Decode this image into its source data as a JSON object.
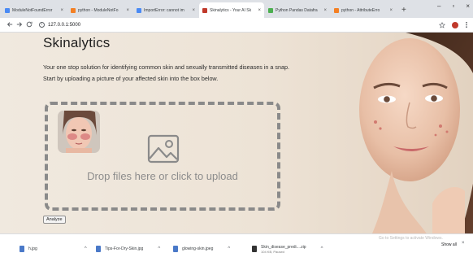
{
  "browser": {
    "tabs": [
      {
        "title": "ModuleNotFoundError",
        "favicon_color": "#4a8af4",
        "active": false
      },
      {
        "title": "python - ModuleNotFo",
        "favicon_color": "#f48024",
        "active": false
      },
      {
        "title": "ImportError: cannot im",
        "favicon_color": "#4a8af4",
        "active": false
      },
      {
        "title": "Skinalytics - Your AI Sk",
        "favicon_color": "#c0392b",
        "active": true
      },
      {
        "title": "Python Pandas Datafra",
        "favicon_color": "#4caf50",
        "active": false
      },
      {
        "title": "python - AttributeErro",
        "favicon_color": "#f48024",
        "active": false
      }
    ],
    "close_glyph": "×",
    "new_tab_glyph": "+",
    "url": "127.0.0.1:5000",
    "window_controls": [
      "–",
      "▫",
      "×"
    ]
  },
  "page": {
    "brand": "Skinalytics",
    "intro_line1": "Your one stop solution for identifying common skin and sexually transmitted diseases in a snap.",
    "intro_line2": "Start by uploading a picture of your affected skin into the box below.",
    "drop_text": "Drop files here or click to upload",
    "analyze_label": "Analyze"
  },
  "downloads": {
    "items": [
      {
        "name": "h.jpg",
        "sub": "",
        "type": "image"
      },
      {
        "name": "Tips-For-Dry-Skin.jpg",
        "sub": "",
        "type": "image"
      },
      {
        "name": "glowing-skin.jpeg",
        "sub": "",
        "type": "image"
      },
      {
        "name": "Skin_disease_predi....zip",
        "sub": "104 KB, Paused",
        "type": "archive"
      }
    ],
    "activate_windows": "Go to Settings to activate Windows.",
    "show_all": "Show all"
  }
}
